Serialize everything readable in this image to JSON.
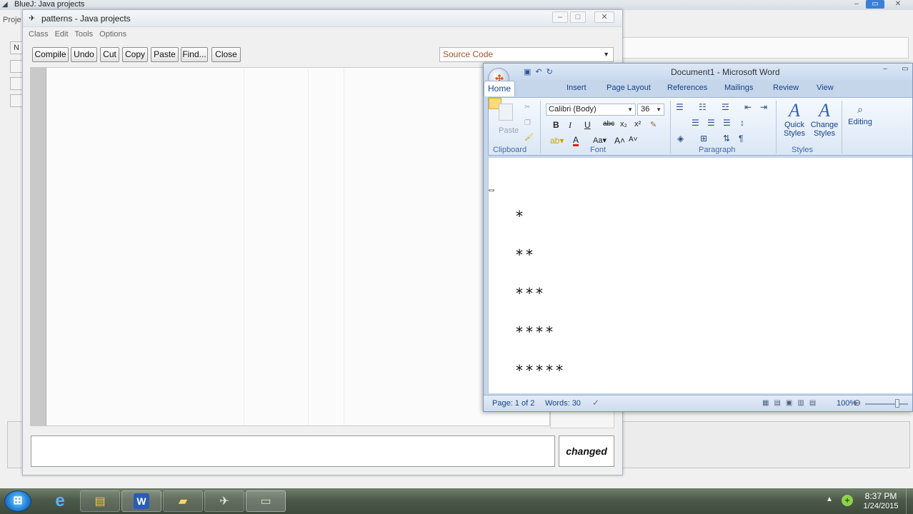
{
  "bg_window": {
    "title": "BlueJ:  Java projects",
    "menu_fragment": "Proje",
    "side_button": "N"
  },
  "editor": {
    "title": "patterns - Java projects",
    "menu": [
      "Class",
      "Edit",
      "Tools",
      "Options"
    ],
    "toolbar": {
      "compile": "Compile",
      "undo": "Undo",
      "cut": "Cut",
      "copy": "Copy",
      "paste": "Paste",
      "find": "Find...",
      "close": "Close"
    },
    "view_select": "Source Code",
    "status_message": "",
    "changed_label": "changed"
  },
  "word": {
    "title": "Document1 - Microsoft Word",
    "tabs": [
      "Home",
      "Insert",
      "Page Layout",
      "References",
      "Mailings",
      "Review",
      "View"
    ],
    "ribbon": {
      "paste_label": "Paste",
      "font_name": "Calibri (Body)",
      "font_size": "36",
      "groups": {
        "clipboard": "Clipboard",
        "font": "Font",
        "paragraph": "Paragraph",
        "styles": "Styles"
      },
      "quick_styles": "Quick Styles",
      "change_styles": "Change Styles",
      "editing": "Editing"
    },
    "document_lines": [
      "*",
      "**",
      "***",
      "****",
      "*****"
    ],
    "status": {
      "page": "Page: 1 of 2",
      "words": "Words: 30",
      "zoom": "100%"
    }
  },
  "taskbar": {
    "time": "8:37 PM",
    "date": "1/24/2015"
  },
  "colors": {
    "word_accent": "#15428b",
    "bluej_select_text": "#a0522d"
  }
}
